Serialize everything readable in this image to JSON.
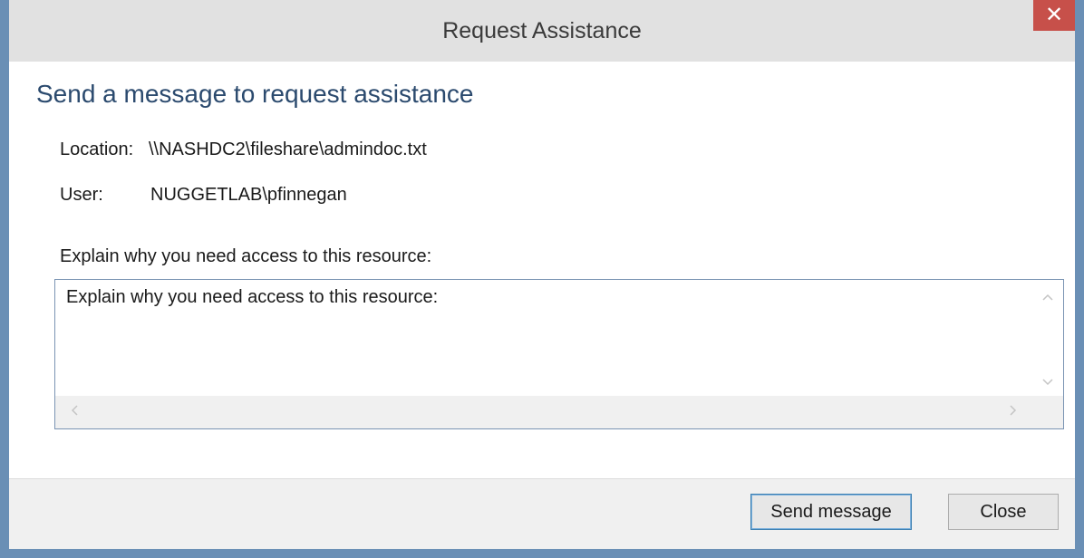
{
  "window": {
    "title": "Request Assistance",
    "close_glyph": "✕"
  },
  "dialog": {
    "heading": "Send a message to request assistance",
    "location_label": "Location:",
    "location_value": "\\\\NASHDC2\\fileshare\\admindoc.txt",
    "user_label": "User:",
    "user_value": "NUGGETLAB\\pfinnegan",
    "explain_label": "Explain why you need access to this resource:",
    "message_text": "Explain why you need access to this resource:"
  },
  "scrollbars": {
    "up_icon": "chevron-up",
    "down_icon": "chevron-down",
    "left_icon": "chevron-left",
    "right_icon": "chevron-right"
  },
  "buttons": {
    "send_label": "Send message",
    "close_label": "Close"
  },
  "colors": {
    "frame": "#6a8fb5",
    "close_button": "#c7504a",
    "heading": "#2b4a6e",
    "focus_border": "#3c7fb1"
  }
}
